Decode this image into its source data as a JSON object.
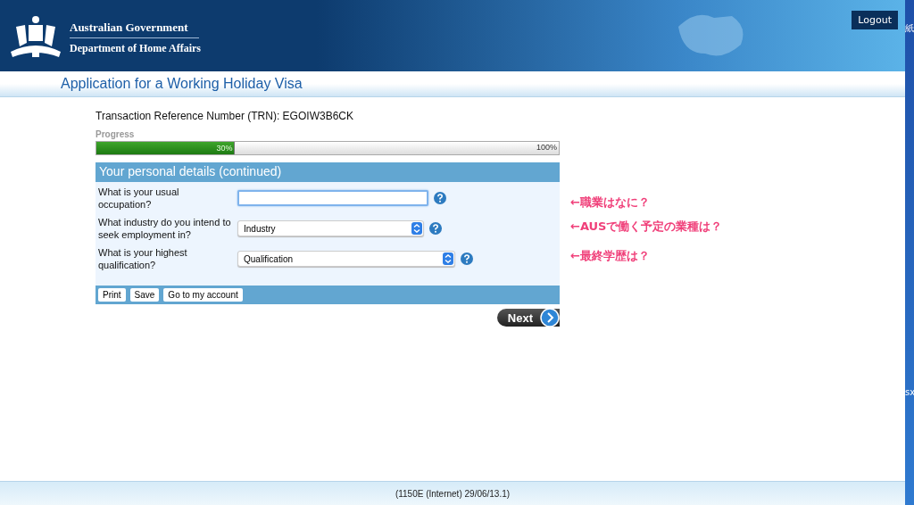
{
  "header": {
    "line_1": "Australian Government",
    "line_2": "Department of Home Affairs",
    "logout": "Logout"
  },
  "page_title": "Application for a Working Holiday Visa",
  "trn": "Transaction Reference Number (TRN): EGOIW3B6CK",
  "progress": {
    "label": "Progress",
    "level": 0.3,
    "reading": "30%",
    "end": "100%"
  },
  "section": {
    "title": "Your personal details (continued)",
    "questions": [
      {
        "kind": "text",
        "label": "What is your usual occupation?",
        "focused": true,
        "note": "←職業はなに？"
      },
      {
        "kind": "select",
        "label": "What industry do you intend to seek employment in?",
        "value": "Industry",
        "note": "←AUSで働く予定の業種は？"
      },
      {
        "kind": "select",
        "label": "What is your highest qualification?",
        "value": "Qualification",
        "note": "←最終学歴は？"
      }
    ],
    "buttons": [
      "Print",
      "Save",
      "Go to my account"
    ]
  },
  "next": "Next",
  "footer": "(1150E (Internet) 29/06/13.1)",
  "desktop_edge": [
    "紙",
    "sx"
  ]
}
